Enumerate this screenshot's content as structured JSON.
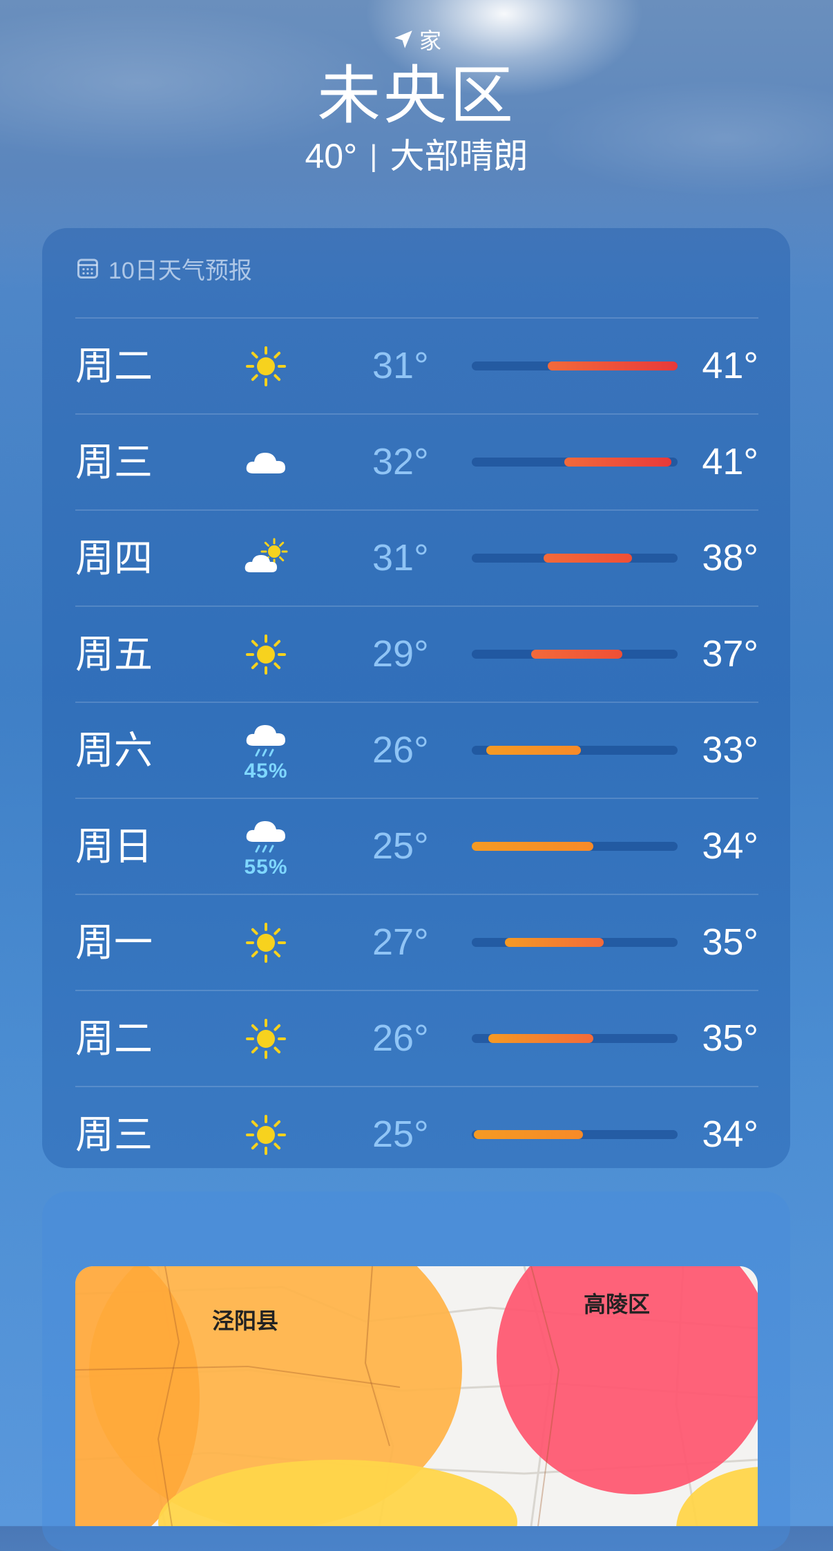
{
  "header": {
    "location_label": "家",
    "city": "未央区",
    "current_temp": "40°",
    "separator": "|",
    "condition": "大部晴朗"
  },
  "forecast": {
    "title": "10日天气预报",
    "rows": [
      {
        "day": "周二",
        "icon": "sun-icon",
        "precip": "",
        "low": "31°",
        "high": "41°",
        "range_start": 0.37,
        "range_end": 1.0
      },
      {
        "day": "周三",
        "icon": "cloud-icon",
        "precip": "",
        "low": "32°",
        "high": "41°",
        "range_start": 0.45,
        "range_end": 0.97
      },
      {
        "day": "周四",
        "icon": "partly-cloudy-icon",
        "precip": "",
        "low": "31°",
        "high": "38°",
        "range_start": 0.35,
        "range_end": 0.78
      },
      {
        "day": "周五",
        "icon": "sun-icon",
        "precip": "",
        "low": "29°",
        "high": "37°",
        "range_start": 0.29,
        "range_end": 0.73
      },
      {
        "day": "周六",
        "icon": "rain-icon",
        "precip": "45%",
        "low": "26°",
        "high": "33°",
        "range_start": 0.07,
        "range_end": 0.53
      },
      {
        "day": "周日",
        "icon": "rain-icon",
        "precip": "55%",
        "low": "25°",
        "high": "34°",
        "range_start": 0.0,
        "range_end": 0.59
      },
      {
        "day": "周一",
        "icon": "sun-icon",
        "precip": "",
        "low": "27°",
        "high": "35°",
        "range_start": 0.16,
        "range_end": 0.64
      },
      {
        "day": "周二",
        "icon": "sun-icon",
        "precip": "",
        "low": "26°",
        "high": "35°",
        "range_start": 0.08,
        "range_end": 0.59
      },
      {
        "day": "周三",
        "icon": "sun-icon",
        "precip": "",
        "low": "25°",
        "high": "34°",
        "range_start": 0.01,
        "range_end": 0.54
      }
    ]
  },
  "map": {
    "labels": [
      "泾阳县",
      "高陵区"
    ]
  },
  "colors": {
    "sun": "#f7d21e",
    "bar_hot": "#e8393a",
    "bar_warm": "#f36a3a",
    "bar_mild": "#f59a23",
    "pop": "#7fd7ff"
  }
}
